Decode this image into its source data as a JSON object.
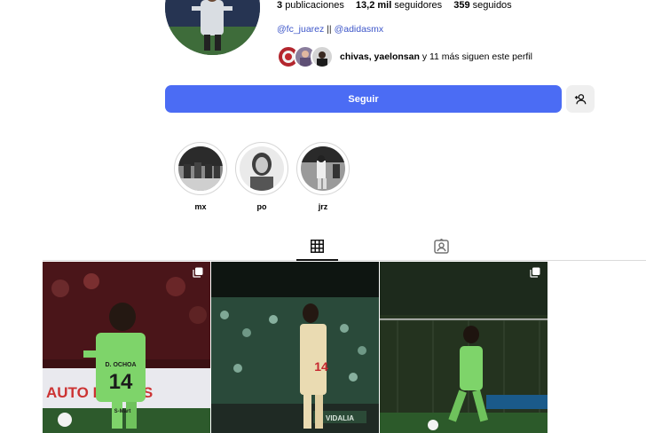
{
  "profile": {
    "stats": {
      "posts_count": "3",
      "posts_label": "publicaciones",
      "followers_count": "13,2 mil",
      "followers_label": "seguidores",
      "following_count": "359",
      "following_label": "seguidos"
    },
    "bio_links": {
      "link1": "@fc_juarez",
      "separator": "||",
      "link2": "@adidasmx"
    },
    "followed_by": {
      "names": "chivas, yaelonsan",
      "suffix": "y 11 más siguen este perfil"
    },
    "follow_button_label": "Seguir",
    "suggest_icon": "add-person-icon"
  },
  "highlights": [
    {
      "label": "mx"
    },
    {
      "label": "po"
    },
    {
      "label": "jrz"
    }
  ],
  "tabs": [
    {
      "name": "posts",
      "icon": "grid-icon",
      "active": true
    },
    {
      "name": "tagged",
      "icon": "tagged-icon",
      "active": false
    }
  ],
  "posts": [
    {
      "id": 1,
      "multi": true,
      "jersey_name": "D. OCHOA",
      "jersey_number": "14",
      "sponsor": "S-Mart",
      "banner": "AUTO PARTES"
    },
    {
      "id": 2,
      "multi": false,
      "jersey_number": "14",
      "banner": "VIDALIA"
    },
    {
      "id": 3,
      "multi": true
    }
  ],
  "colors": {
    "accent": "#4b6cf4",
    "link": "#3d56c9",
    "divider": "#dbdbdb",
    "jersey_green": "#7ed46a"
  }
}
